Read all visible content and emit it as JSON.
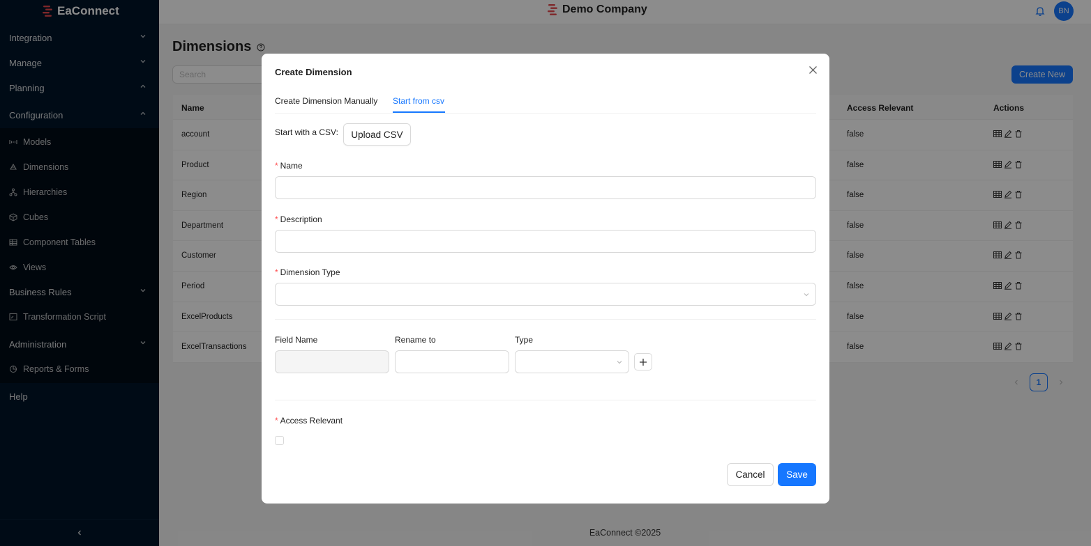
{
  "app": {
    "name": "EaConnect",
    "company": "Demo Company",
    "user_initials": "BN"
  },
  "sidebar": {
    "groups": [
      {
        "label": "Integration",
        "chevron": "down"
      },
      {
        "label": "Manage",
        "chevron": "down"
      },
      {
        "label": "Planning",
        "chevron": "up"
      },
      {
        "label": "Configuration",
        "chevron": "up"
      },
      {
        "label": "Business Rules",
        "chevron": "down"
      },
      {
        "label": "Administration",
        "chevron": "down"
      },
      {
        "label": "Help"
      }
    ],
    "items": [
      {
        "label": "Models",
        "icon": "models-icon"
      },
      {
        "label": "Dimensions",
        "icon": "dimensions-icon"
      },
      {
        "label": "Hierarchies",
        "icon": "hierarchies-icon"
      },
      {
        "label": "Cubes",
        "icon": "cube-icon"
      },
      {
        "label": "Component Tables",
        "icon": "table-icon"
      },
      {
        "label": "Views",
        "icon": "eye-icon"
      },
      {
        "label": "Transformation Script",
        "icon": "script-icon"
      },
      {
        "label": "Reports & Forms",
        "icon": "pie-chart-icon"
      }
    ]
  },
  "page": {
    "title": "Dimensions",
    "search_placeholder": "Search",
    "create_new": "Create New",
    "table": {
      "headers": {
        "name": "Name",
        "access": "Access Relevant",
        "actions": "Actions"
      },
      "rows": [
        {
          "name": "account",
          "access": "false"
        },
        {
          "name": "Product",
          "access": "false"
        },
        {
          "name": "Region",
          "access": "false"
        },
        {
          "name": "Department",
          "access": "false"
        },
        {
          "name": "Customer",
          "access": "false"
        },
        {
          "name": "Period",
          "access": "false"
        },
        {
          "name": "ExcelProducts",
          "access": "false"
        },
        {
          "name": "ExcelTransactions",
          "access": "false"
        }
      ]
    },
    "pagination": {
      "current": "1"
    },
    "footer": "EaConnect ©2025"
  },
  "modal": {
    "title": "Create Dimension",
    "tabs": [
      "Create Dimension Manually",
      "Start from csv"
    ],
    "active_tab": 1,
    "csv_label": "Start with a CSV",
    "upload_label": "Upload CSV",
    "fields": {
      "name_label": "Name",
      "description_label": "Description",
      "type_label": "Dimension Type",
      "name_value": "",
      "description_value": ""
    },
    "mapping": {
      "field_name": "Field Name",
      "rename_to": "Rename to",
      "type": "Type"
    },
    "access_label": "Access Relevant",
    "access_checked": false,
    "cancel": "Cancel",
    "save": "Save"
  },
  "colors": {
    "sidebar_bg": "#001529",
    "primary": "#1677ff",
    "required": "#ff4d4f",
    "logo_red": "#e5484d"
  }
}
